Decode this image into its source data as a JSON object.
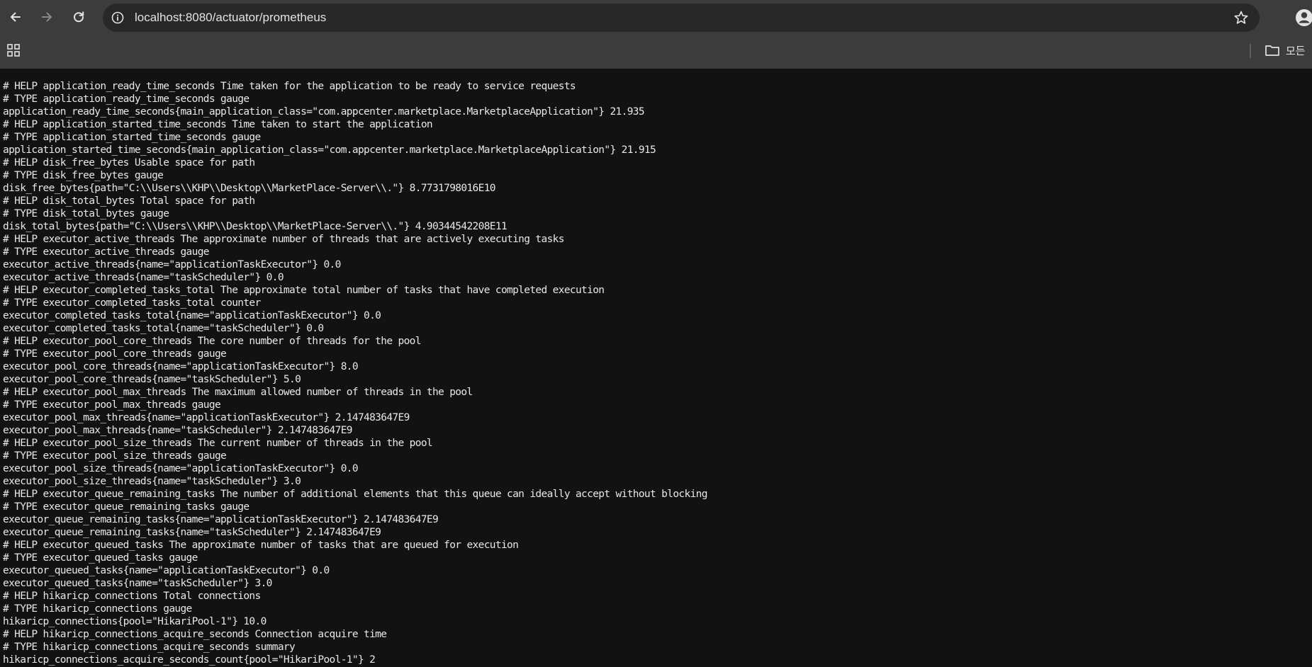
{
  "browser": {
    "url": "localhost:8080/actuator/prometheus",
    "bookmarks_bar": {
      "all_bookmarks_label": "모든"
    }
  },
  "page": {
    "lines": [
      "# HELP application_ready_time_seconds Time taken for the application to be ready to service requests",
      "# TYPE application_ready_time_seconds gauge",
      "application_ready_time_seconds{main_application_class=\"com.appcenter.marketplace.MarketplaceApplication\"} 21.935",
      "# HELP application_started_time_seconds Time taken to start the application",
      "# TYPE application_started_time_seconds gauge",
      "application_started_time_seconds{main_application_class=\"com.appcenter.marketplace.MarketplaceApplication\"} 21.915",
      "# HELP disk_free_bytes Usable space for path",
      "# TYPE disk_free_bytes gauge",
      "disk_free_bytes{path=\"C:\\\\Users\\\\KHP\\\\Desktop\\\\MarketPlace-Server\\\\.\"} 8.7731798016E10",
      "# HELP disk_total_bytes Total space for path",
      "# TYPE disk_total_bytes gauge",
      "disk_total_bytes{path=\"C:\\\\Users\\\\KHP\\\\Desktop\\\\MarketPlace-Server\\\\.\"} 4.90344542208E11",
      "# HELP executor_active_threads The approximate number of threads that are actively executing tasks",
      "# TYPE executor_active_threads gauge",
      "executor_active_threads{name=\"applicationTaskExecutor\"} 0.0",
      "executor_active_threads{name=\"taskScheduler\"} 0.0",
      "# HELP executor_completed_tasks_total The approximate total number of tasks that have completed execution",
      "# TYPE executor_completed_tasks_total counter",
      "executor_completed_tasks_total{name=\"applicationTaskExecutor\"} 0.0",
      "executor_completed_tasks_total{name=\"taskScheduler\"} 0.0",
      "# HELP executor_pool_core_threads The core number of threads for the pool",
      "# TYPE executor_pool_core_threads gauge",
      "executor_pool_core_threads{name=\"applicationTaskExecutor\"} 8.0",
      "executor_pool_core_threads{name=\"taskScheduler\"} 5.0",
      "# HELP executor_pool_max_threads The maximum allowed number of threads in the pool",
      "# TYPE executor_pool_max_threads gauge",
      "executor_pool_max_threads{name=\"applicationTaskExecutor\"} 2.147483647E9",
      "executor_pool_max_threads{name=\"taskScheduler\"} 2.147483647E9",
      "# HELP executor_pool_size_threads The current number of threads in the pool",
      "# TYPE executor_pool_size_threads gauge",
      "executor_pool_size_threads{name=\"applicationTaskExecutor\"} 0.0",
      "executor_pool_size_threads{name=\"taskScheduler\"} 3.0",
      "# HELP executor_queue_remaining_tasks The number of additional elements that this queue can ideally accept without blocking",
      "# TYPE executor_queue_remaining_tasks gauge",
      "executor_queue_remaining_tasks{name=\"applicationTaskExecutor\"} 2.147483647E9",
      "executor_queue_remaining_tasks{name=\"taskScheduler\"} 2.147483647E9",
      "# HELP executor_queued_tasks The approximate number of tasks that are queued for execution",
      "# TYPE executor_queued_tasks gauge",
      "executor_queued_tasks{name=\"applicationTaskExecutor\"} 0.0",
      "executor_queued_tasks{name=\"taskScheduler\"} 3.0",
      "# HELP hikaricp_connections Total connections",
      "# TYPE hikaricp_connections gauge",
      "hikaricp_connections{pool=\"HikariPool-1\"} 10.0",
      "# HELP hikaricp_connections_acquire_seconds Connection acquire time",
      "# TYPE hikaricp_connections_acquire_seconds summary",
      "hikaricp_connections_acquire_seconds_count{pool=\"HikariPool-1\"} 2"
    ]
  }
}
